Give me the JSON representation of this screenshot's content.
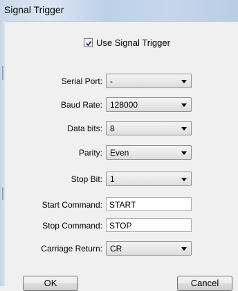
{
  "window": {
    "title": "Signal Trigger"
  },
  "use_signal_trigger": {
    "label": "Use Signal Trigger",
    "checked": true
  },
  "fields": {
    "serial_port": {
      "label": "Serial Port:",
      "value": "-"
    },
    "baud_rate": {
      "label": "Baud Rate:",
      "value": "128000"
    },
    "data_bits": {
      "label": "Data bits:",
      "value": "8"
    },
    "parity": {
      "label": "Parity:",
      "value": "Even"
    },
    "stop_bit": {
      "label": "Stop Bit:",
      "value": "1"
    },
    "start_command": {
      "label": "Start Command:",
      "value": "START"
    },
    "stop_command": {
      "label": "Stop Command:",
      "value": "STOP"
    },
    "carriage_return": {
      "label": "Carriage Return:",
      "value": "CR"
    }
  },
  "buttons": {
    "ok": "OK",
    "cancel": "Cancel"
  }
}
